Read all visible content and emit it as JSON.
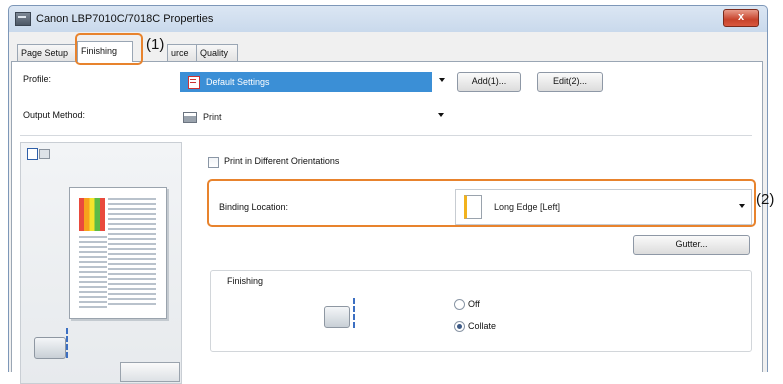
{
  "window": {
    "title": "Canon LBP7010C/7018C Properties",
    "close_label": "x"
  },
  "tabs": [
    {
      "label": "Page Setup",
      "active": false
    },
    {
      "label": "Finishing",
      "active": true
    },
    {
      "label": "urce",
      "active": false
    },
    {
      "label": "Quality",
      "active": false
    }
  ],
  "profile": {
    "label": "Profile:",
    "value": "Default Settings",
    "add_label": "Add(1)...",
    "edit_label": "Edit(2)..."
  },
  "output": {
    "label": "Output Method:",
    "value": "Print"
  },
  "print_orientations": {
    "label": "Print in Different Orientations",
    "checked": false
  },
  "binding": {
    "label": "Binding Location:",
    "value": "Long Edge [Left]"
  },
  "gutter": {
    "label": "Gutter..."
  },
  "finishing": {
    "label": "Finishing",
    "options": [
      {
        "label": "Off",
        "selected": false
      },
      {
        "label": "Collate",
        "selected": true
      }
    ]
  },
  "callouts": {
    "one": "(1)",
    "two": "(2)"
  },
  "colors": {
    "accent": "#e8832d",
    "selection": "#3b8fd6"
  }
}
